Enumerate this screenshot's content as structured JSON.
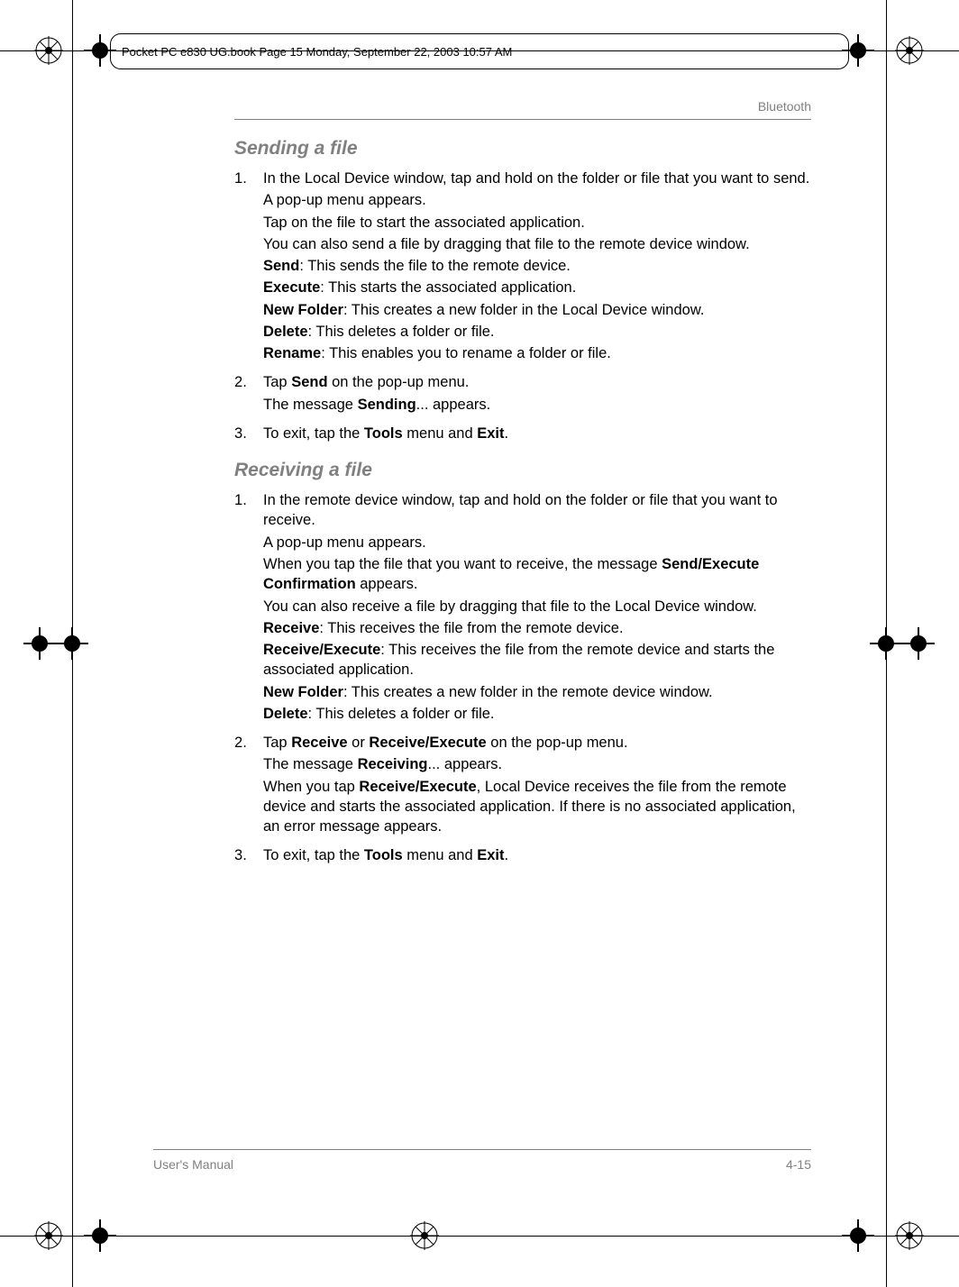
{
  "header": {
    "runner": "Pocket PC e830 UG.book  Page 15  Monday, September 22, 2003  10:57 AM"
  },
  "topic": "Bluetooth",
  "section1": {
    "title": "Sending a file",
    "items": [
      {
        "lines": [
          "In the Local Device window, tap and hold on the folder or file that you want to send.",
          "A pop-up menu appears.",
          "Tap on the file to start the associated application.",
          "You can also send a file by dragging that file to the remote device window.",
          "<b>Send</b>: This sends the file to the remote device.",
          "<b>Execute</b>: This starts the associated application.",
          "<b>New Folder</b>: This creates a new folder in the Local Device window.",
          "<b>Delete</b>: This deletes a folder or file.",
          "<b>Rename</b>: This enables you to rename a folder or file."
        ]
      },
      {
        "lines": [
          "Tap <b>Send</b> on the pop-up menu.",
          "The message <b>Sending</b>... appears."
        ]
      },
      {
        "lines": [
          "To exit, tap the <b>Tools</b> menu and <b>Exit</b>."
        ]
      }
    ]
  },
  "section2": {
    "title": "Receiving a file",
    "items": [
      {
        "lines": [
          "In the remote device window, tap and hold on the folder or file that you want to receive.",
          "A pop-up menu appears.",
          "When you tap the file that you want to receive, the message <b>Send/Execute Confirmation</b> appears.",
          "You can also receive a file by dragging that file to the Local Device window.",
          "<b>Receive</b>: This receives the file from the remote device.",
          "<b>Receive/Execute</b>: This receives the file from the remote device and starts the associated application.",
          "<b>New Folder</b>: This creates a new folder in the remote device window.",
          "<b>Delete</b>: This deletes a folder or file."
        ]
      },
      {
        "lines": [
          "Tap <b>Receive</b> or <b>Receive/Execute</b> on the pop-up menu.",
          "The message <b>Receiving</b>... appears.",
          "When you tap <b>Receive/Execute</b>, Local Device receives the file from the remote device and starts the associated application. If there is no associated application, an error message appears."
        ]
      },
      {
        "lines": [
          "To exit, tap the <b>Tools</b> menu and <b>Exit</b>."
        ]
      }
    ]
  },
  "footer": {
    "left": "User's Manual",
    "right": "4-15"
  }
}
